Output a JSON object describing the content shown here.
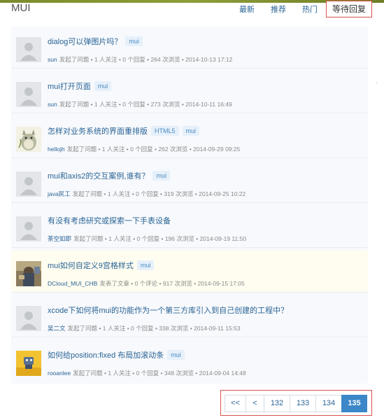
{
  "header": {
    "brand": "MUI",
    "tabs": [
      {
        "label": "最新"
      },
      {
        "label": "推荐"
      },
      {
        "label": "热门"
      },
      {
        "label": "等待回复"
      }
    ]
  },
  "topics": [
    {
      "title": "dialog可以弹图片吗？",
      "tag": "mui",
      "author": "sun",
      "action": "发起了问题",
      "stats": "• 1 人关注 • 0 个回复 • 264 次浏览 • 2014-10-13 17:12",
      "avatar": "default-avatar"
    },
    {
      "title": "mui打开页面",
      "tag": "mui",
      "author": "sun",
      "action": "发起了问题",
      "stats": "• 1 人关注 • 0 个回复 • 273 次浏览 • 2014-10-11 16:49",
      "avatar": "default-avatar"
    },
    {
      "title": "怎样对业务系统的界面重排版",
      "tag": "HTML5",
      "tag2": "mui",
      "author": "hellojh",
      "action": "发起了问题",
      "stats": "• 1 人关注 • 0 个回复 • 262 次浏览 • 2014-09-29 09:25",
      "avatar": "totoro-avatar"
    },
    {
      "title": "mui和axis2的交互案例,谁有？",
      "tag": "mui",
      "author": "java民工",
      "action": "发起了问题",
      "stats": "• 1 人关注 • 0 个回复 • 319 次浏览 • 2014-09-25 10:22",
      "avatar": "default-avatar"
    },
    {
      "title": "有没有考虑研究或探索一下手表设备",
      "tag": "",
      "author": "茶空如即",
      "action": "发起了问题",
      "stats": "• 1 人关注 • 0 个回复 • 196 次浏览 • 2014-09-19 11:50",
      "avatar": "default-avatar"
    },
    {
      "title": "mui如何自定义9宫格样式",
      "tag": "mui",
      "author": "DCloud_MUI_CHB",
      "action": "发表了文章",
      "stats": "• 0 个评论 • 917 次浏览 • 2014-09-15 17:05",
      "avatar": "photo-avatar"
    },
    {
      "title": "xcode下如何将mui的功能作为一个第三方库引入到自己创建的工程中？",
      "tag": "",
      "author": "吴二文",
      "action": "发起了问题",
      "stats": "• 1 人关注 • 0 个回复 • 338 次浏览 • 2014-09-11 15:53",
      "avatar": "default-avatar"
    },
    {
      "title": "如何给position:fixed 布局加滚动条",
      "tag": "mui",
      "author": "rooanlee",
      "action": "发起了问题",
      "stats": "• 1 人关注 • 0 个回复 • 348 次浏览 • 2014-09-04 14:48",
      "avatar": "robot-avatar"
    }
  ],
  "pagination": {
    "first": "<<",
    "prev": "<",
    "pages": [
      "132",
      "133",
      "134",
      "135"
    ],
    "current": "135"
  },
  "colors": {
    "link": "#2a6496",
    "active_page": "#3b87c8",
    "highlight_box": "#d9534f"
  }
}
